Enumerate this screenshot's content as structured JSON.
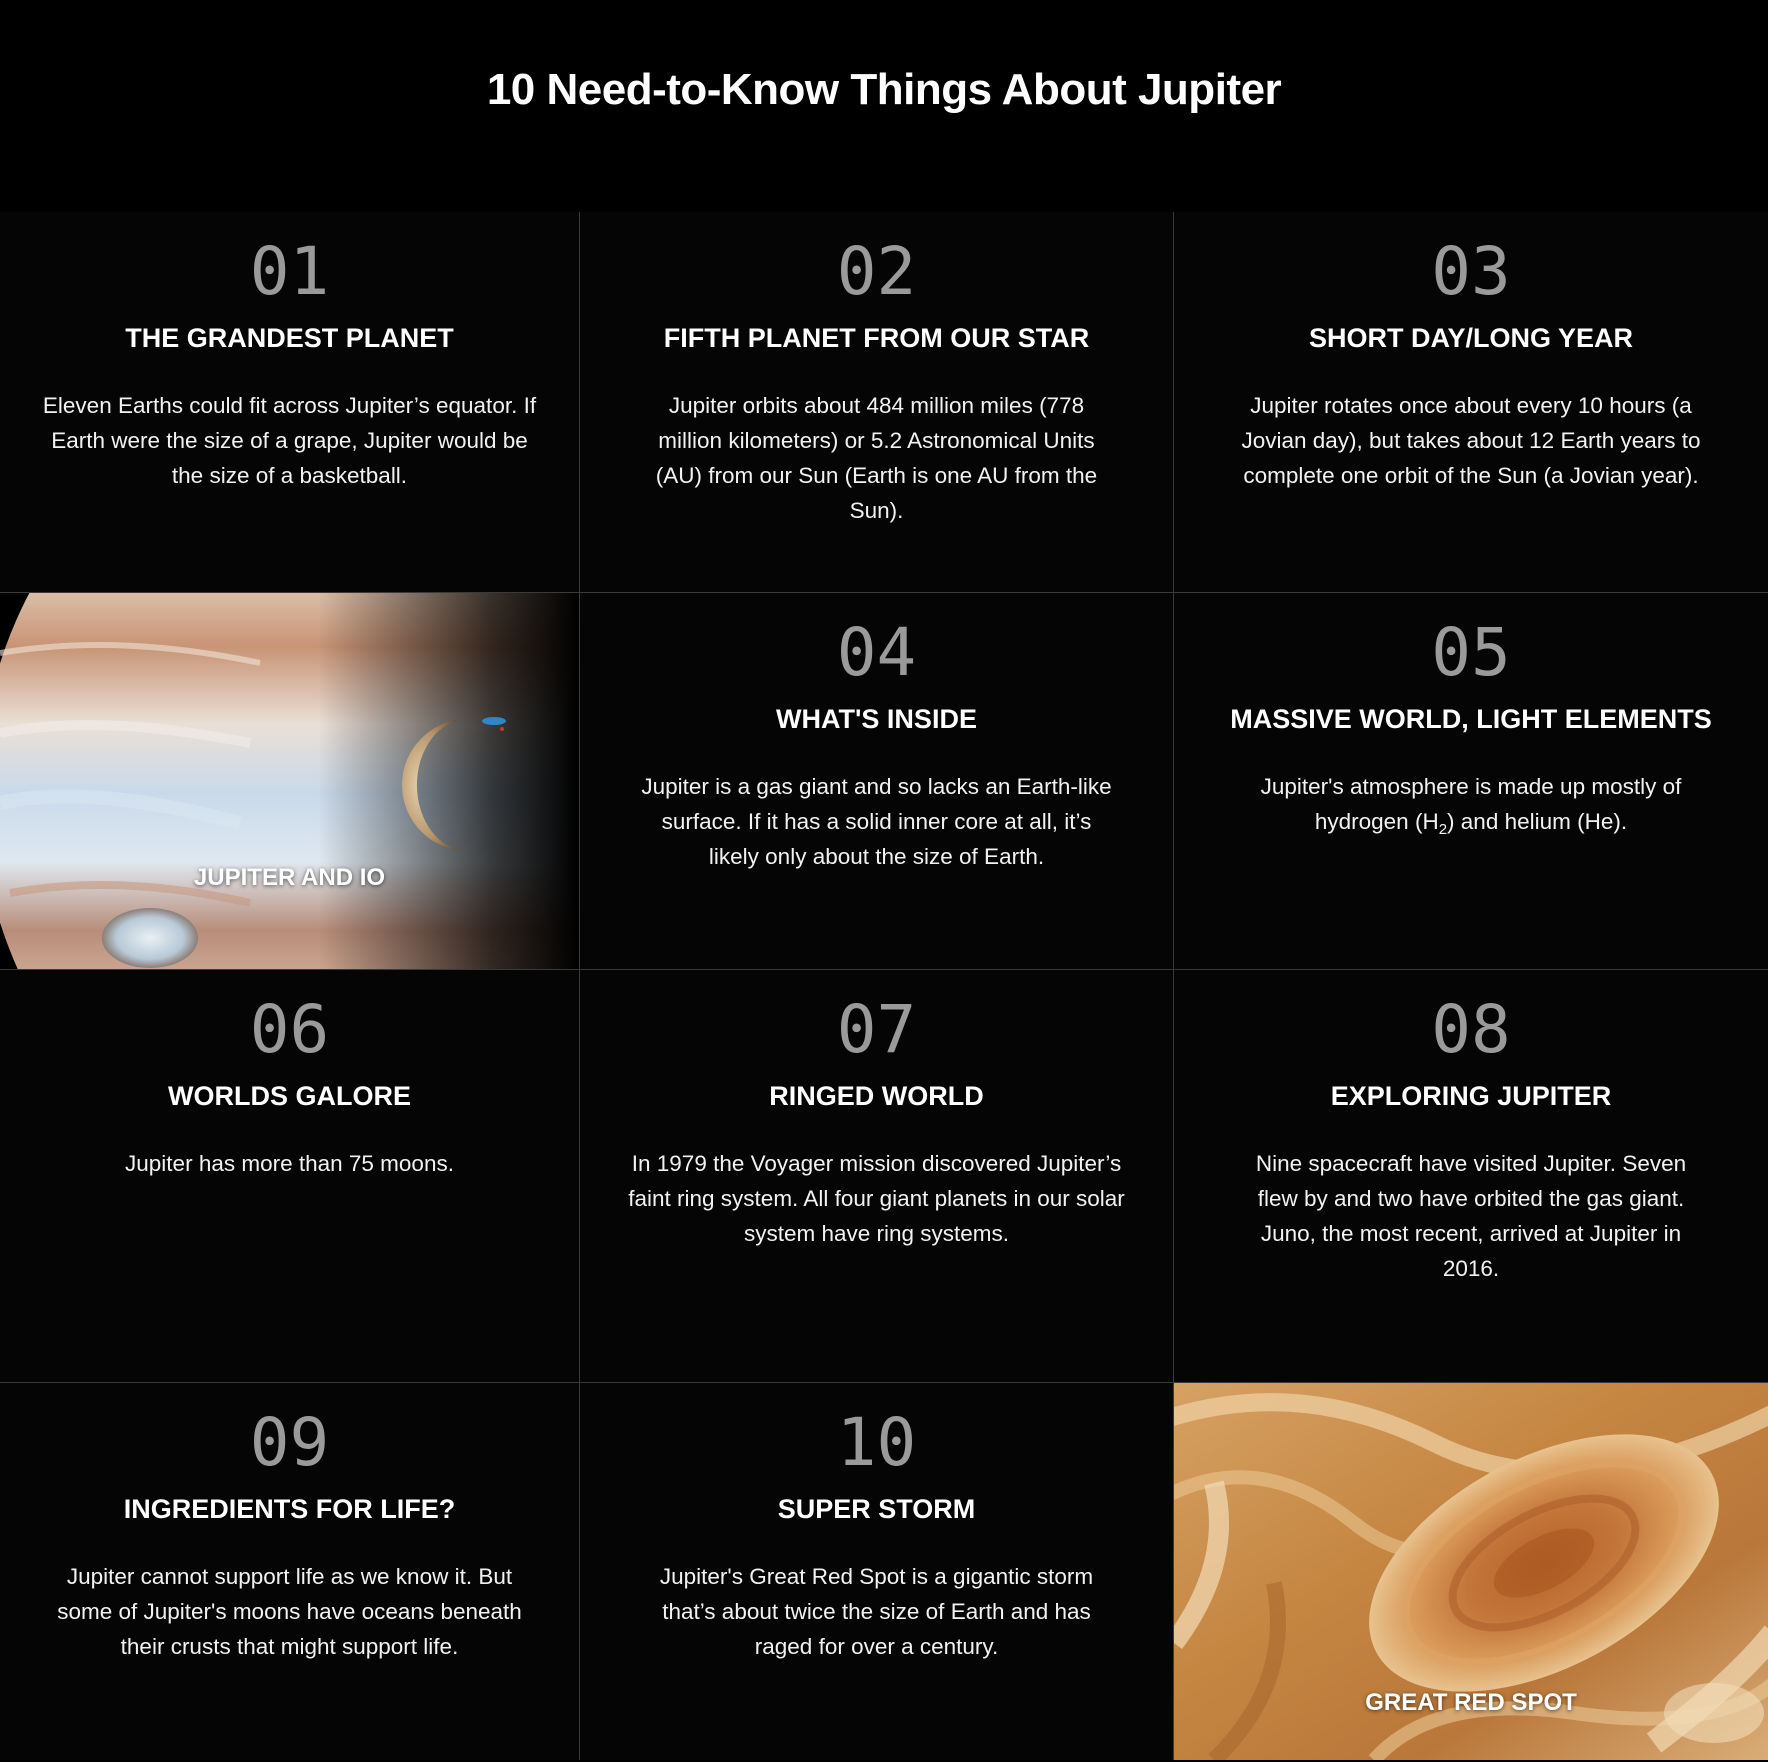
{
  "page": {
    "title": "10 Need-to-Know Things About Jupiter"
  },
  "facts": [
    {
      "number": "01",
      "heading": "THE GRANDEST PLANET",
      "body": "Eleven Earths could fit across Jupiter’s equator. If Earth were the size of a grape, Jupiter would be the size of a basketball."
    },
    {
      "number": "02",
      "heading": "FIFTH PLANET FROM OUR STAR",
      "body": "Jupiter orbits about 484 million miles (778 million kilometers) or 5.2 Astronomical Units (AU) from our Sun (Earth is one AU from the Sun)."
    },
    {
      "number": "03",
      "heading": "SHORT DAY/LONG YEAR",
      "body": "Jupiter rotates once about every 10 hours (a Jovian day), but takes about 12 Earth years to complete one orbit of the Sun (a Jovian year)."
    },
    {
      "number": "04",
      "heading": "WHAT'S INSIDE",
      "body": "Jupiter is a gas giant and so lacks an Earth-like surface. If it has a solid inner core at all, it’s likely only about the size of Earth."
    },
    {
      "number": "05",
      "heading": "MASSIVE WORLD, LIGHT ELEMENTS",
      "body_pre": "Jupiter's atmosphere is made up mostly of hydrogen (H",
      "body_sub": "2",
      "body_post": ") and helium (He)."
    },
    {
      "number": "06",
      "heading": "WORLDS GALORE",
      "body": "Jupiter has more than 75 moons."
    },
    {
      "number": "07",
      "heading": "RINGED WORLD",
      "body": "In 1979 the Voyager mission discovered Jupiter’s faint ring system. All four giant planets in our solar system have ring systems."
    },
    {
      "number": "08",
      "heading": "EXPLORING JUPITER",
      "body": "Nine spacecraft have visited Jupiter. Seven flew by and two have orbited the gas giant. Juno, the most recent, arrived at Jupiter in 2016."
    },
    {
      "number": "09",
      "heading": "INGREDIENTS FOR LIFE?",
      "body": "Jupiter cannot support life as we know it. But some of Jupiter's moons have oceans beneath their crusts that might support life."
    },
    {
      "number": "10",
      "heading": "SUPER STORM",
      "body": "Jupiter's Great Red Spot is a gigantic storm that’s about twice the size of Earth and has raged for over a century."
    }
  ],
  "photos": {
    "jupiter_io": {
      "caption": "JUPITER AND IO"
    },
    "great_red_spot": {
      "caption": "GREAT RED SPOT"
    }
  },
  "colors": {
    "background": "#000000",
    "number_gray": "#9a9a9a",
    "divider": "#3a3a3a"
  }
}
